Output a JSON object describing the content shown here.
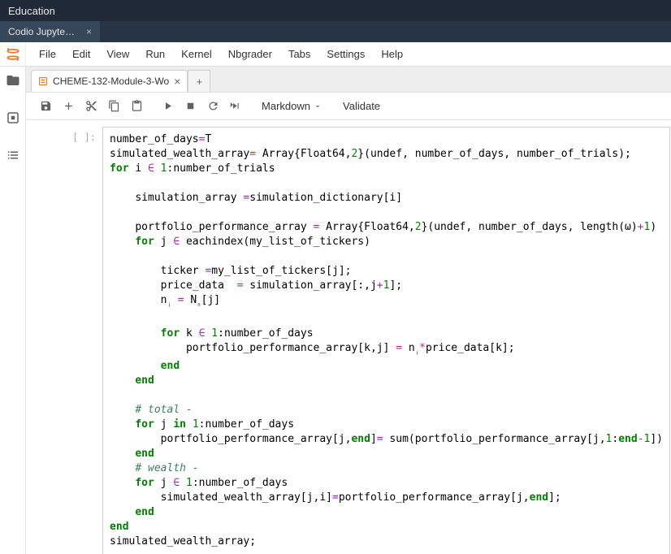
{
  "title": "Education",
  "app_tab": {
    "label": "Codio Jupyte…"
  },
  "menu": [
    "File",
    "Edit",
    "View",
    "Run",
    "Kernel",
    "Nbgrader",
    "Tabs",
    "Settings",
    "Help"
  ],
  "file_tab": {
    "label": "CHEME-132-Module-3-Wo"
  },
  "toolbar": {
    "cell_format": "Markdown",
    "validate": "Validate"
  },
  "prompt": "[ ]:",
  "code": {
    "l1a": "number_of_days",
    "l1b": "=",
    "l1c": "T",
    "l2a": "simulated_wealth_array",
    "l2b": "=",
    "l2c": " Array{Float64,",
    "l2d": "2",
    "l2e": "}(undef, number_of_days, number_of_trials);",
    "l3a": "for",
    "l3b": " i ",
    "l3c": "∈",
    "l3d": " ",
    "l3e": "1",
    "l3f": ":number_of_trials",
    "l5a": "    simulation_array ",
    "l5b": "=",
    "l5c": "simulation_dictionary[i]",
    "l7a": "    portfolio_performance_array ",
    "l7b": "=",
    "l7c": " Array{Float64,",
    "l7d": "2",
    "l7e": "}(undef, number_of_days, length(ω)",
    "l7f": "+",
    "l7g": "1",
    "l7h": ")",
    "l8a": "    ",
    "l8b": "for",
    "l8c": " j ",
    "l8d": "∈",
    "l8e": " eachindex(my_list_of_tickers)",
    "l10a": "        ticker ",
    "l10b": "=",
    "l10c": "my_list_of_tickers[j];",
    "l11a": "        price_data  ",
    "l11b": "=",
    "l11c": " simulation_array[:,j",
    "l11d": "+",
    "l11e": "1",
    "l11f": "];",
    "l12a": "        n",
    "l12b": "ⱼ",
    "l12c": " ",
    "l12d": "=",
    "l12e": " N",
    "l12f": "ₒ",
    "l12g": "[j]",
    "l14a": "        ",
    "l14b": "for",
    "l14c": " k ",
    "l14d": "∈",
    "l14e": " ",
    "l14f": "1",
    "l14g": ":number_of_days",
    "l15a": "            portfolio_performance_array[k,j] ",
    "l15b": "=",
    "l15c": " n",
    "l15d": "ⱼ",
    "l15e": "*",
    "l15f": "price_data[k];",
    "l16a": "        ",
    "l16b": "end",
    "l17a": "    ",
    "l17b": "end",
    "l19a": "    ",
    "l19b": "# total -",
    "l20a": "    ",
    "l20b": "for",
    "l20c": " j ",
    "l20d": "in",
    "l20e": " ",
    "l20f": "1",
    "l20g": ":number_of_days",
    "l21a": "        portfolio_performance_array[j,",
    "l21b": "end",
    "l21c": "]",
    "l21d": "=",
    "l21e": " sum(portfolio_performance_array[j,",
    "l21f": "1",
    "l21g": ":",
    "l21h": "end",
    "l21i": "-",
    "l21j": "1",
    "l21k": "])",
    "l22a": "    ",
    "l22b": "end",
    "l23a": "    ",
    "l23b": "# wealth -",
    "l24a": "    ",
    "l24b": "for",
    "l24c": " j ",
    "l24d": "∈",
    "l24e": " ",
    "l24f": "1",
    "l24g": ":number_of_days",
    "l25a": "        simulated_wealth_array[j,i]",
    "l25b": "=",
    "l25c": "portfolio_performance_array[j,",
    "l25d": "end",
    "l25e": "];",
    "l26a": "    ",
    "l26b": "end",
    "l27a": "end",
    "l28a": "simulated_wealth_array;"
  }
}
